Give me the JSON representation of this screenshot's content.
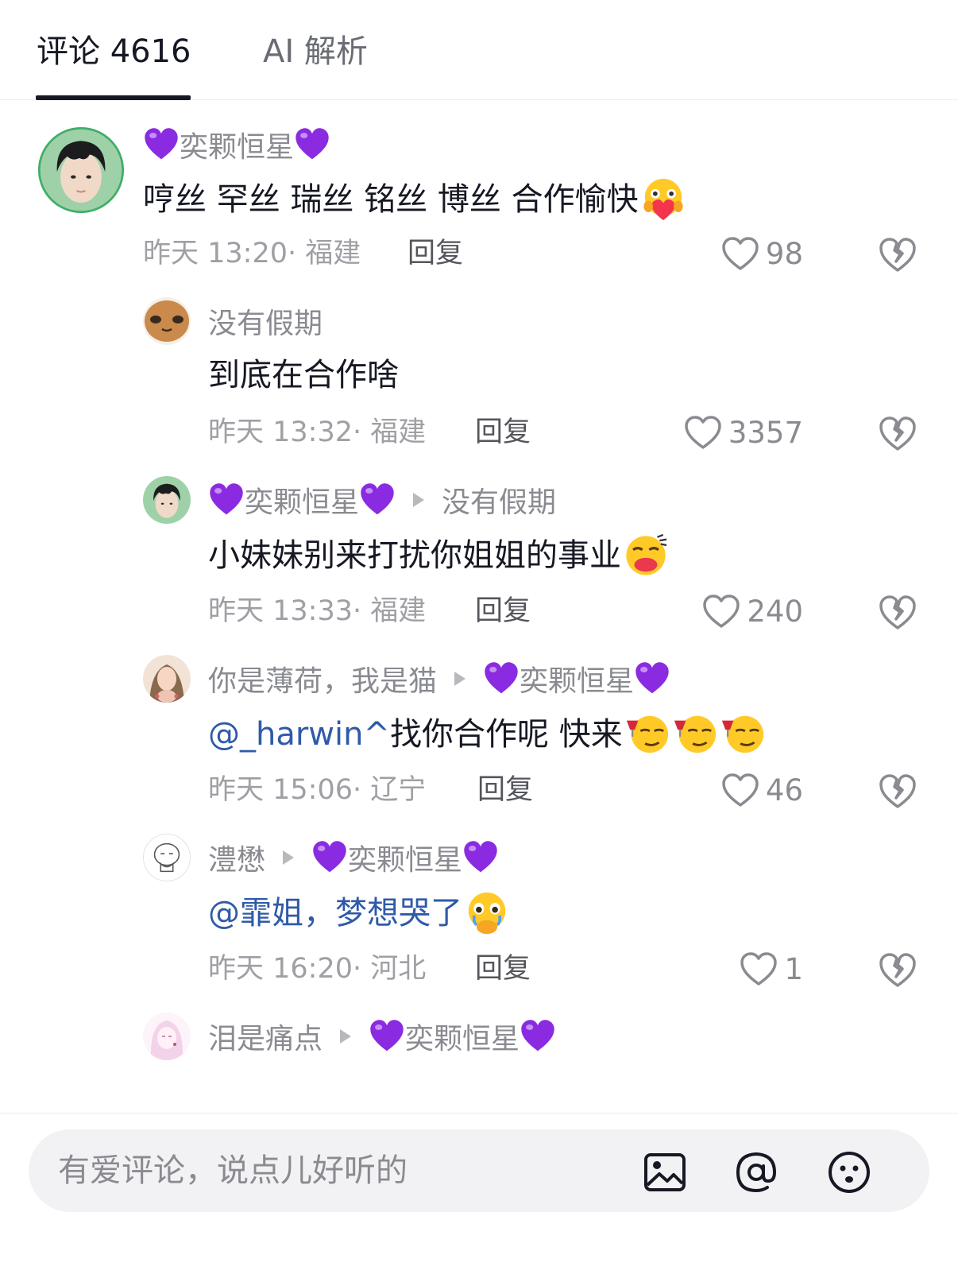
{
  "tabs": {
    "comments_label": "评论 4616",
    "ai_label": "AI 解析"
  },
  "comments": [
    {
      "user": "奕颗恒星",
      "text": "哼丝 罕丝 瑞丝 铭丝 博丝 合作愉快",
      "emoji": "hug-face-emoji",
      "time": "昨天 13:20",
      "location": "福建",
      "reply_label": "回复",
      "likes": "98"
    },
    {
      "user": "没有假期",
      "text": "到底在合作啥",
      "time": "昨天 13:32",
      "location": "福建",
      "reply_label": "回复",
      "likes": "3357"
    },
    {
      "user": "奕颗恒星",
      "reply_to": "没有假期",
      "text": "小妹妹别来打扰你姐姐的事业",
      "emoji": "kissing-face-emoji",
      "time": "昨天 13:33",
      "location": "福建",
      "reply_label": "回复",
      "likes": "240"
    },
    {
      "user": "你是薄荷，我是猫",
      "reply_to": "奕颗恒星",
      "mention": "@_harwin^",
      "text": " 找你合作呢 快来",
      "emoji": "smirk-wine-face-emoji",
      "time": "昨天 15:06",
      "location": "辽宁",
      "reply_label": "回复",
      "likes": "46"
    },
    {
      "user": "澧懋",
      "reply_to": "奕颗恒星",
      "mention": "@霏姐",
      "text": "，梦想哭了 ",
      "emoji": "holding-back-tears-emoji",
      "time": "昨天 16:20",
      "location": "河北",
      "reply_label": "回复",
      "likes": "1"
    },
    {
      "user": "泪是痛点",
      "reply_to": "奕颗恒星"
    }
  ],
  "input": {
    "placeholder": "有爱评论，说点儿好听的"
  },
  "icons": {
    "purple_heart": "purple-heart-emoji",
    "like": "heart-outline-icon",
    "dislike": "broken-heart-icon",
    "image": "image-icon",
    "mention": "at-icon",
    "emoji": "smiley-icon"
  },
  "colors": {
    "accent_purple": "#8a2be2",
    "mention_blue": "#2f5aa8",
    "text_primary": "#161823",
    "text_secondary": "#9fa0a5"
  }
}
